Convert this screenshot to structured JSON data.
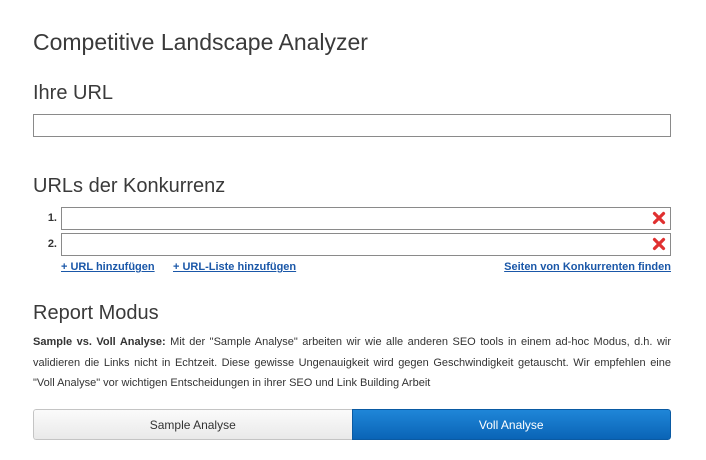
{
  "title": "Competitive Landscape Analyzer",
  "your_url": {
    "heading": "Ihre URL",
    "value": ""
  },
  "competitors": {
    "heading": "URLs der Konkurrenz",
    "rows": [
      {
        "num": "1.",
        "value": ""
      },
      {
        "num": "2.",
        "value": ""
      }
    ],
    "remove_icon": "red-x-icon",
    "remove_color": "#e03030",
    "add_url_link": "+ URL hinzufügen",
    "add_list_link": "+ URL-Liste hinzufügen",
    "find_link": "Seiten von Konkurrenten finden"
  },
  "report": {
    "heading": "Report Modus",
    "desc_bold": "Sample vs. Voll Analyse:",
    "desc_text": " Mit der \"Sample Analyse\" arbeiten wir wie alle anderen SEO tools in einem ad-hoc Modus, d.h. wir validieren die Links nicht in Echtzeit. Diese gewisse Ungenauigkeit wird gegen Geschwindigkeit getauscht. Wir empfehlen eine \"Voll Analyse\" vor wichtigen Entscheidungen in ihrer SEO und Link Building Arbeit",
    "mode_sample": "Sample Analyse",
    "mode_full": "Voll Analyse",
    "selected_mode": "Voll Analyse",
    "accent_color": "#0a6fc4"
  }
}
